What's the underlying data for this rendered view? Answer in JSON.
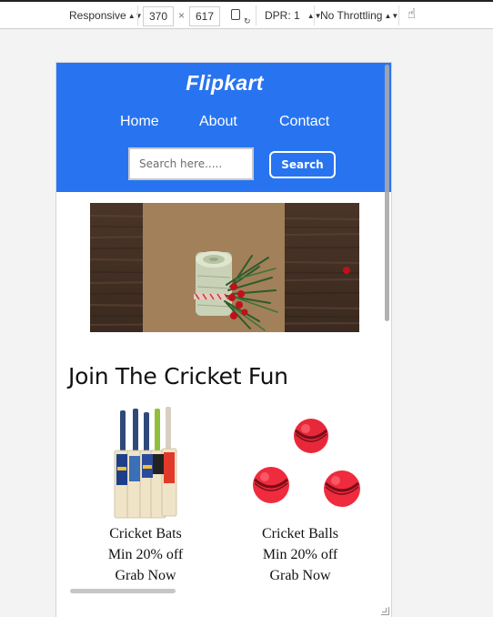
{
  "devtools": {
    "device_mode": "Responsive",
    "width": "370",
    "times": "×",
    "height": "617",
    "dpr": "DPR: 1",
    "throttling": "No Throttling"
  },
  "site": {
    "logo": "Flipkart",
    "nav": [
      "Home",
      "About",
      "Contact"
    ],
    "search_placeholder": "Search here.....",
    "search_button": "Search",
    "brand_color": "#2874f0"
  },
  "section": {
    "title": "Join The Cricket Fun"
  },
  "products": [
    {
      "name": "Cricket Bats",
      "offer": "Min 20% off",
      "cta": "Grab Now"
    },
    {
      "name": "Cricket Balls",
      "offer": "Min 20% off",
      "cta": "Grab Now"
    }
  ]
}
